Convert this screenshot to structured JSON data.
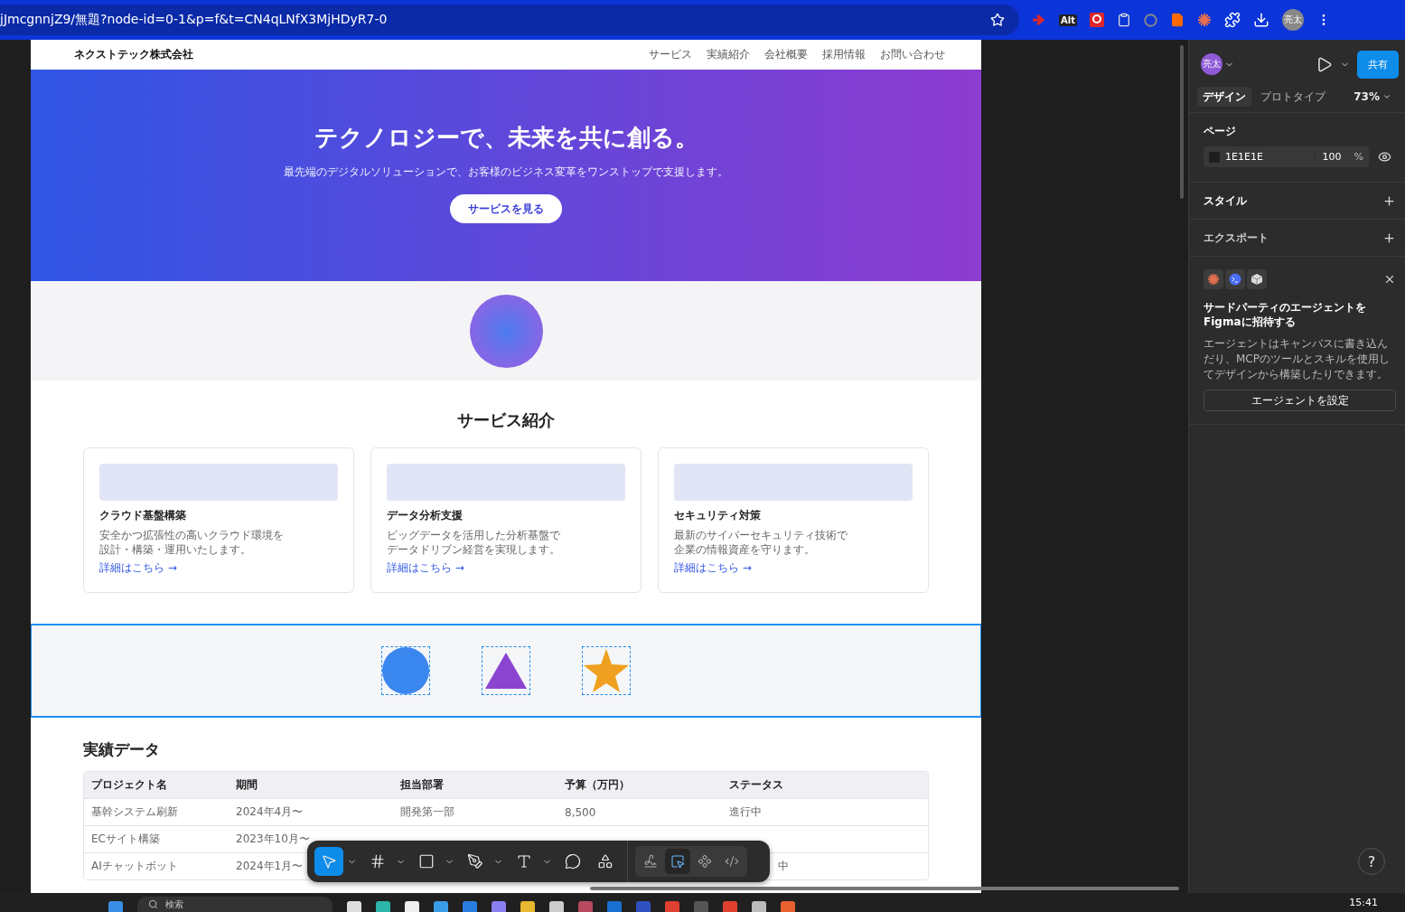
{
  "browser": {
    "url": "jJmcgnnjZ9/無題?node-id=0-1&p=f&t=CN4qLNfX3MjHDyR7-0",
    "extensions": [
      {
        "kind": "arrow"
      },
      {
        "kind": "badge",
        "label": "Alt"
      },
      {
        "kind": "pin"
      },
      {
        "kind": "clipboard"
      },
      {
        "kind": "ring"
      },
      {
        "kind": "file"
      },
      {
        "kind": "burst"
      },
      {
        "kind": "puzzle"
      }
    ],
    "profile": "亮太"
  },
  "site": {
    "logo": "ネクストテック株式会社",
    "nav": [
      "サービス",
      "実績紹介",
      "会社概要",
      "採用情報",
      "お問い合わせ"
    ],
    "hero": {
      "title": "テクノロジーで、未来を共に創る。",
      "subtitle": "最先端のデジタルソリューションで、お客様のビジネス変革をワンストップで支援します。",
      "button": "サービスを見る"
    },
    "services": {
      "heading": "サービス紹介",
      "cards": [
        {
          "title": "クラウド基盤構築",
          "lines": [
            "安全かつ拡張性の高いクラウド環境を",
            "設計・構築・運用いたします。"
          ],
          "link": "詳細はこちら →"
        },
        {
          "title": "データ分析支援",
          "lines": [
            "ビッグデータを活用した分析基盤で",
            "データドリブン経営を実現します。"
          ],
          "link": "詳細はこちら →"
        },
        {
          "title": "セキュリティ対策",
          "lines": [
            "最新のサイバーセキュリティ技術で",
            "企業の情報資産を守ります。"
          ],
          "link": "詳細はこちら →"
        }
      ]
    },
    "shapes": {
      "selected": true,
      "items": [
        {
          "kind": "circle",
          "color": "#3b87f0"
        },
        {
          "kind": "triangle",
          "color": "#8a44d0"
        },
        {
          "kind": "star",
          "color": "#f0a020"
        }
      ]
    },
    "results": {
      "heading": "実績データ",
      "columns": [
        "プロジェクト名",
        "期間",
        "担当部署",
        "予算（万円）",
        "ステータス"
      ],
      "rows": [
        {
          "project": "基幹システム刷新",
          "period": "2024年4月〜",
          "department": "開発第一部",
          "budget": "8,500",
          "status": "進行中"
        },
        {
          "project": "ECサイト構築",
          "period": "2023年10月〜"
        },
        {
          "project": "AIチャットボット",
          "period": "2024年1月〜",
          "status": "中",
          "status_cut_left": true
        }
      ]
    }
  },
  "toolbar": {
    "tools": [
      {
        "kind": "move",
        "selected": true
      },
      {
        "kind": "frame",
        "selected": false
      },
      {
        "kind": "rectangle",
        "selected": false
      },
      {
        "kind": "pen",
        "selected": false
      },
      {
        "kind": "text",
        "selected": false
      },
      {
        "kind": "comment",
        "selected": false
      },
      {
        "kind": "actions",
        "selected": false
      }
    ],
    "modes": [
      {
        "kind": "draw",
        "selected": false
      },
      {
        "kind": "design",
        "selected": true
      },
      {
        "kind": "component",
        "selected": false
      },
      {
        "kind": "code",
        "selected": false
      }
    ]
  },
  "panel": {
    "avatar": "亮太",
    "share": "共有",
    "tabs": [
      {
        "label": "デザイン",
        "selected": true
      },
      {
        "label": "プロトタイプ",
        "selected": false
      }
    ],
    "zoom": "73%",
    "page": {
      "title": "ページ",
      "fill": "1E1E1E",
      "opacity": "100",
      "unit": "%"
    },
    "sections": [
      {
        "title": "スタイル"
      },
      {
        "title": "エクスポート"
      }
    ],
    "agent": {
      "title": "サードパーティのエージェントをFigmaに招待する",
      "body": "エージェントはキャンバスに書き込んだり、MCPのツールとスキルを使用してデザインから構築したりできます。",
      "button": "エージェントを設定"
    },
    "help": "?"
  },
  "taskbar": {
    "search": "検索",
    "time": "15:41"
  }
}
